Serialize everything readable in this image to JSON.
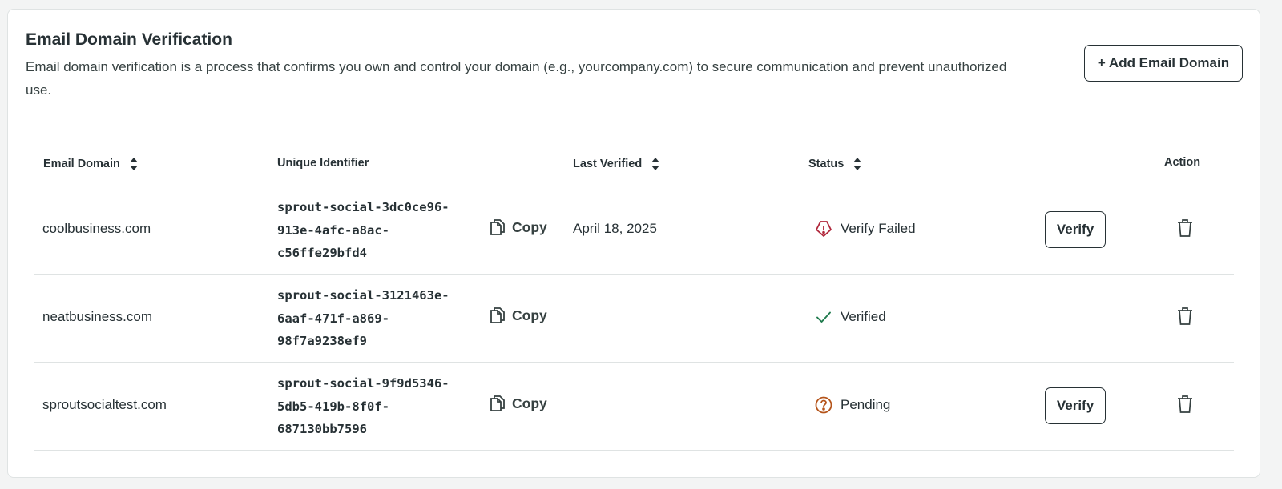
{
  "header": {
    "title": "Email Domain Verification",
    "description": "Email domain verification is a process that confirms you own and control your domain (e.g., yourcompany.com) to secure communication and prevent unauthorized use.",
    "add_button_label": "+ Add Email Domain"
  },
  "table": {
    "columns": {
      "email_domain": "Email Domain",
      "unique_identifier": "Unique Identifier",
      "last_verified": "Last Verified",
      "status": "Status",
      "action": "Action"
    },
    "copy_label": "Copy",
    "verify_label": "Verify",
    "rows": [
      {
        "domain": "coolbusiness.com",
        "uid_lines": [
          "sprout-social-3dc0ce96-",
          "913e-4afc-a8ac-",
          "c56ffe29bfd4"
        ],
        "last_verified": "April 18, 2025",
        "status": "Verify Failed",
        "status_icon": "warning-icon",
        "show_verify": true
      },
      {
        "domain": "neatbusiness.com",
        "uid_lines": [
          "sprout-social-3121463e-",
          "6aaf-471f-a869-",
          "98f7a9238ef9"
        ],
        "last_verified": "",
        "status": "Verified",
        "status_icon": "check-icon",
        "show_verify": false
      },
      {
        "domain": "sproutsocialtest.com",
        "uid_lines": [
          "sprout-social-9f9d5346-",
          "5db5-419b-8f0f-",
          "687130bb7596"
        ],
        "last_verified": "",
        "status": "Pending",
        "status_icon": "question-icon",
        "show_verify": true
      }
    ]
  },
  "colors": {
    "text": "#273135",
    "border": "#dfe3e3",
    "error": "#b0263a",
    "success": "#1f7a4d",
    "pending": "#b5541a",
    "background": "#f3f4f4"
  }
}
